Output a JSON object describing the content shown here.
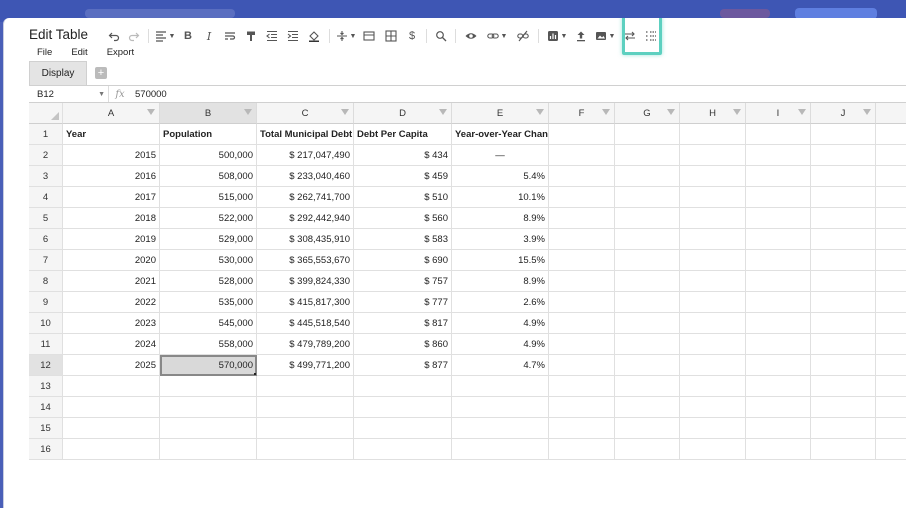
{
  "dialog": {
    "title": "Edit Table"
  },
  "toolbar": {
    "icons": [
      "undo-icon",
      "redo-icon",
      "align-icon",
      "bold-icon",
      "italic-icon",
      "wrap-text-icon",
      "paint-format-icon",
      "indent-decrease-icon",
      "indent-increase-icon",
      "fill-color-icon",
      "vertical-align-icon",
      "merge-cells-icon",
      "borders-icon",
      "currency-icon",
      "search-icon",
      "view-icon",
      "link-icon",
      "unlink-icon",
      "insert-chart-icon",
      "upload-icon",
      "insert-image-icon",
      "swap-icon",
      "more-icon"
    ]
  },
  "menu": {
    "file": "File",
    "edit": "Edit",
    "export": "Export"
  },
  "sheet_tabs": {
    "active": "Display",
    "add": "+"
  },
  "formula_bar": {
    "cell_ref": "B12",
    "fx": "fx",
    "value": "570000"
  },
  "columns": [
    "A",
    "B",
    "C",
    "D",
    "E",
    "F",
    "G",
    "H",
    "I",
    "J"
  ],
  "header_row": [
    "Year",
    "Population",
    "Total Municipal Debt (",
    "Debt Per Capita",
    "Year-over-Year Chang"
  ],
  "rows": [
    [
      "2015",
      "500,000",
      "$ 217,047,490",
      "$ 434",
      "—"
    ],
    [
      "2016",
      "508,000",
      "$ 233,040,460",
      "$ 459",
      "5.4%"
    ],
    [
      "2017",
      "515,000",
      "$ 262,741,700",
      "$ 510",
      "10.1%"
    ],
    [
      "2018",
      "522,000",
      "$ 292,442,940",
      "$ 560",
      "8.9%"
    ],
    [
      "2019",
      "529,000",
      "$ 308,435,910",
      "$ 583",
      "3.9%"
    ],
    [
      "2020",
      "530,000",
      "$ 365,553,670",
      "$ 690",
      "15.5%"
    ],
    [
      "2021",
      "528,000",
      "$ 399,824,330",
      "$ 757",
      "8.9%"
    ],
    [
      "2022",
      "535,000",
      "$ 415,817,300",
      "$ 777",
      "2.6%"
    ],
    [
      "2023",
      "545,000",
      "$ 445,518,540",
      "$ 817",
      "4.9%"
    ],
    [
      "2024",
      "558,000",
      "$ 479,789,200",
      "$ 860",
      "4.9%"
    ],
    [
      "2025",
      "570,000",
      "$ 499,771,200",
      "$ 877",
      "4.7%"
    ]
  ],
  "row_numbers": [
    "1",
    "2",
    "3",
    "4",
    "5",
    "6",
    "7",
    "8",
    "9",
    "10",
    "11",
    "12",
    "13",
    "14",
    "15",
    "16"
  ],
  "colors": {
    "highlight": "#5dd0c0",
    "backdrop": "#4a5fb8"
  }
}
